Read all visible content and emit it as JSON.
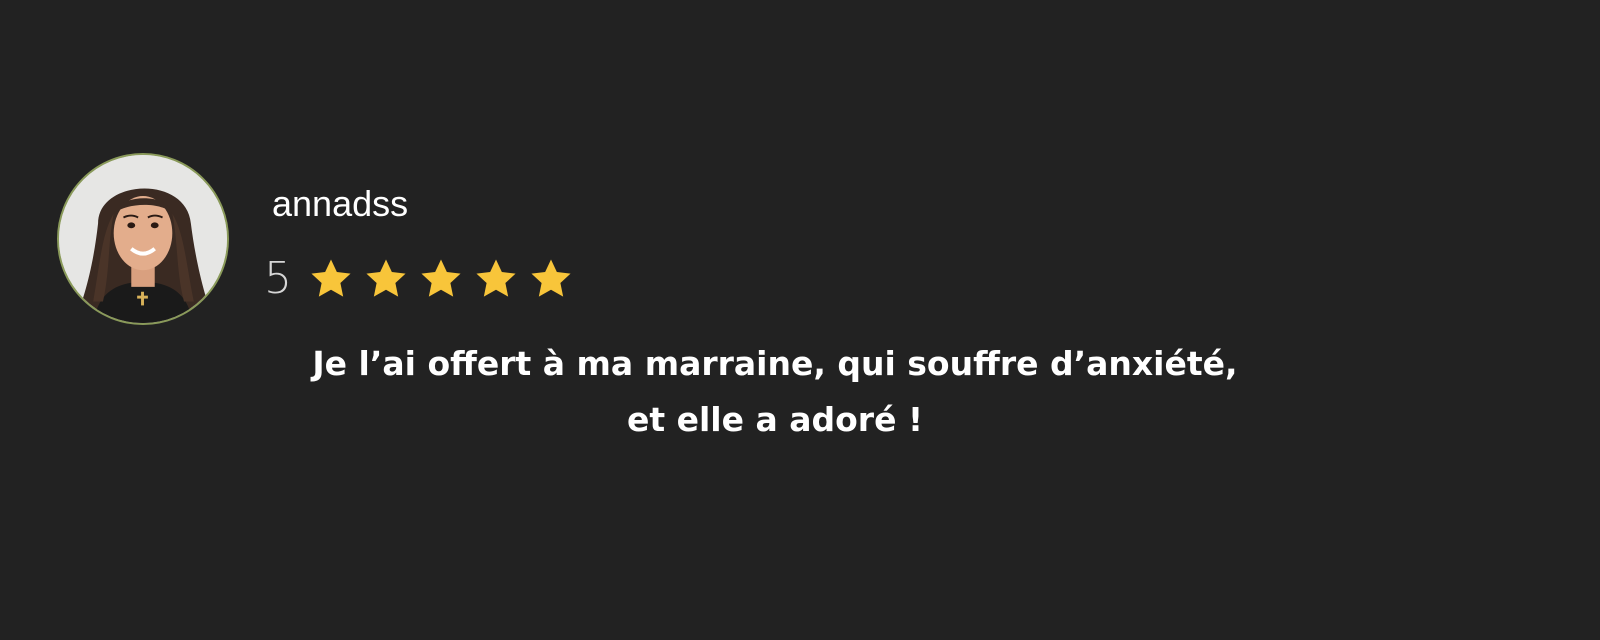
{
  "review": {
    "username": "annadss",
    "rating": 5,
    "rating_label": "5",
    "max_rating": 5,
    "star_color": "#f8c53a",
    "avatar_icon": "user-photo-avatar",
    "text_lines": [
      "Je l’ai offert à ma marraine, qui souffre d’anxiété,",
      "et elle a adoré !"
    ]
  }
}
